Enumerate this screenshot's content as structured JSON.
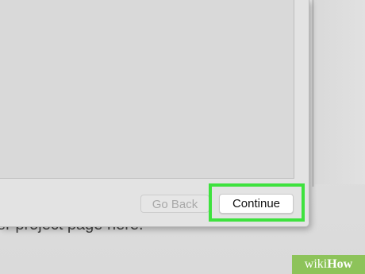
{
  "background": {
    "text": "er project page here."
  },
  "dialog": {
    "buttons": {
      "back_label": "Go Back",
      "continue_label": "Continue"
    }
  },
  "watermark": {
    "prefix": "wiki",
    "suffix": "How"
  },
  "colors": {
    "highlight": "#3ee23e",
    "watermark_bg": "#8dc35a"
  }
}
